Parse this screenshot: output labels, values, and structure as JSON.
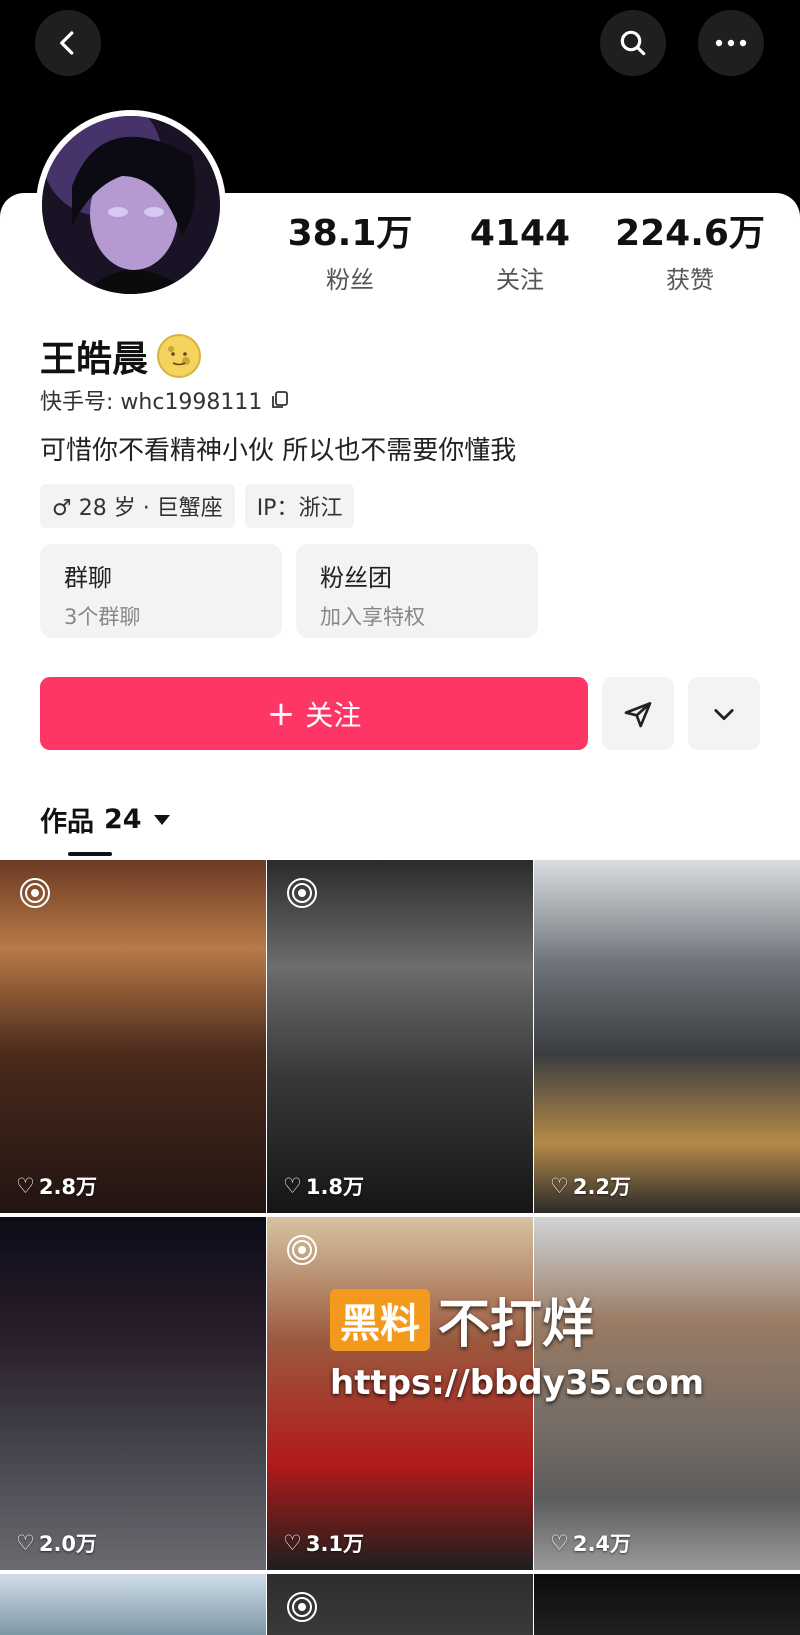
{
  "header": {
    "back_icon": "chevron-left-icon",
    "search_icon": "search-icon",
    "more_icon": "more-horizontal-icon"
  },
  "profile": {
    "name": "王皓晨",
    "name_emoji": "moon-face-emoji",
    "kwai_id_label": "快手号: whc1998111",
    "bio": "可惜你不看精神小伙 所以也不需要你懂我",
    "tags": [
      "♂ 28 岁 · 巨蟹座",
      "IP：浙江"
    ]
  },
  "stats": [
    {
      "value": "38.1万",
      "label": "粉丝"
    },
    {
      "value": "4144",
      "label": "关注"
    },
    {
      "value": "224.6万",
      "label": "获赞"
    }
  ],
  "features": [
    {
      "title": "群聊",
      "subtitle": "3个群聊"
    },
    {
      "title": "粉丝团",
      "subtitle": "加入享特权"
    }
  ],
  "actions": {
    "follow_label": "关注",
    "follow_plus": "+",
    "share_icon": "send-icon",
    "dropdown_icon": "chevron-down-icon"
  },
  "works": {
    "label": "作品",
    "count": "24"
  },
  "grid": [
    {
      "likes": "2.8万",
      "live": true
    },
    {
      "likes": "1.8万",
      "live": true
    },
    {
      "likes": "2.2万",
      "live": false
    },
    {
      "likes": "2.0万",
      "live": false
    },
    {
      "likes": "3.1万",
      "live": true
    },
    {
      "likes": "2.4万",
      "live": false
    },
    {
      "likes": "",
      "live": false
    },
    {
      "likes": "",
      "live": true
    },
    {
      "likes": "",
      "live": false
    }
  ],
  "watermark": {
    "box_text": "黑料",
    "text": "不打烊",
    "url": "https://bbdy35.com"
  },
  "colors": {
    "accent": "#fe3666",
    "background": "#000000",
    "card": "#ffffff"
  }
}
